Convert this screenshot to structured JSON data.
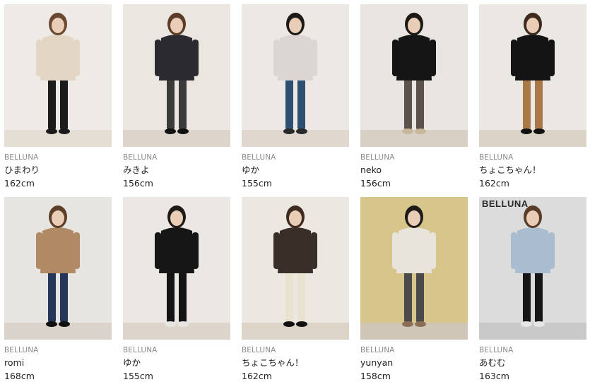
{
  "cards": [
    {
      "brand": "BELLUNA",
      "name": "ひまわり",
      "height": "162cm",
      "bg": "#eeebe7",
      "floor": "#e4ddd4",
      "top": "#e3d6c5",
      "bottom": "#1c1c1c",
      "hair": "#6b4a33",
      "shoe": "#1a1a1a"
    },
    {
      "brand": "BELLUNA",
      "name": "みきよ",
      "height": "156cm",
      "bg": "#ebe6e0",
      "floor": "#ddd5cb",
      "top": "#2a2a30",
      "bottom": "#3b3b3b",
      "hair": "#5a3c28",
      "shoe": "#111111"
    },
    {
      "brand": "BELLUNA",
      "name": "ゆか",
      "height": "155cm",
      "bg": "#ece8e3",
      "floor": "#e0d8ce",
      "top": "#d9d6d4",
      "bottom": "#2f4f72",
      "hair": "#1e1a18",
      "shoe": "#2a2a2a"
    },
    {
      "brand": "BELLUNA",
      "name": "neko",
      "height": "156cm",
      "bg": "#e9e6e2",
      "floor": "#d8d0c5",
      "top": "#151515",
      "bottom": "#5b524b",
      "hair": "#1c1816",
      "shoe": "#c9b79c"
    },
    {
      "brand": "BELLUNA",
      "name": "ちょこちゃん！",
      "height": "162cm",
      "bg": "#ebe7e2",
      "floor": "#dcd3c7",
      "top": "#141414",
      "bottom": "#a97a48",
      "hair": "#3e2a1e",
      "shoe": "#111111"
    },
    {
      "brand": "BELLUNA",
      "name": "romi",
      "height": "168cm",
      "bg": "#e7e5e2",
      "floor": "#d9d3cb",
      "top": "#b08a64",
      "bottom": "#26365a",
      "hair": "#5c3e29",
      "shoe": "#111111"
    },
    {
      "brand": "BELLUNA",
      "name": "ゆか",
      "height": "155cm",
      "bg": "#ebe7e3",
      "floor": "#ddd5cb",
      "top": "#161616",
      "bottom": "#141414",
      "hair": "#1e1a18",
      "shoe": "#e8e4e0"
    },
    {
      "brand": "BELLUNA",
      "name": "ちょこちゃん！",
      "height": "162cm",
      "bg": "#ebe7e1",
      "floor": "#ddd4c8",
      "top": "#3a2f28",
      "bottom": "#e9e2cf",
      "hair": "#3e2a1e",
      "shoe": "#111111"
    },
    {
      "brand": "BELLUNA",
      "name": "yunyan",
      "height": "158cm",
      "bg": "#d7c58a",
      "floor": "#cfc6b8",
      "top": "#e8e4dc",
      "bottom": "#4a4a4a",
      "hair": "#1d1a18",
      "shoe": "#8a6f55"
    },
    {
      "brand": "BELLUNA",
      "name": "あむむ",
      "height": "163cm",
      "bg": "#dcdcdc",
      "floor": "#c9c9c9",
      "top": "#a9bcd0",
      "bottom": "#161616",
      "hair": "#5a3c28",
      "shoe": "#e6e6e6"
    }
  ],
  "signage_text": "BELLUNA"
}
